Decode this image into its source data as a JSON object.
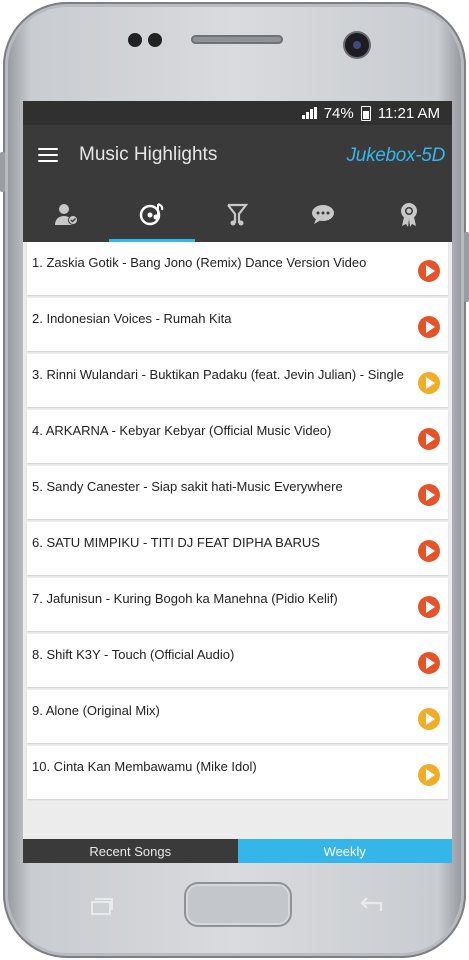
{
  "status_bar": {
    "signal": "signal-icon",
    "battery": "74%",
    "time": "11:21 AM"
  },
  "app_bar": {
    "title": "Music Highlights",
    "logo": "Jukebox-5D"
  },
  "tabs": [
    {
      "icon": "user-check-icon",
      "active": false
    },
    {
      "icon": "music-disc-icon",
      "active": true
    },
    {
      "icon": "music-chart-icon",
      "active": false
    },
    {
      "icon": "chat-icon",
      "active": false
    },
    {
      "icon": "award-icon",
      "active": false
    }
  ],
  "songs": [
    {
      "label": "1.  Zaskia Gotik - Bang Jono (Remix) Dance Version Video",
      "play_color": "red"
    },
    {
      "label": "2.  Indonesian Voices - Rumah Kita",
      "play_color": "red"
    },
    {
      "label": "3.  Rinni Wulandari - Buktikan Padaku (feat. Jevin Julian) - Single",
      "play_color": "yellow"
    },
    {
      "label": "4.  ARKARNA - Kebyar Kebyar (Official Music Video)",
      "play_color": "red"
    },
    {
      "label": "5.  Sandy Canester - Siap sakit hati-Music Everywhere",
      "play_color": "red"
    },
    {
      "label": "6.  SATU MIMPIKU - TITI DJ FEAT DIPHA BARUS",
      "play_color": "red"
    },
    {
      "label": "7.  Jafunisun - Kuring Bogoh ka Manehna (Pidio Kelif)",
      "play_color": "red"
    },
    {
      "label": "8.  Shift K3Y - Touch (Official Audio)",
      "play_color": "red"
    },
    {
      "label": "9.  Alone (Original Mix)",
      "play_color": "yellow"
    },
    {
      "label": "10.  Cinta Kan Membawamu (Mike Idol)",
      "play_color": "yellow"
    }
  ],
  "bottom_tabs": {
    "recent": "Recent Songs",
    "weekly": "Weekly"
  },
  "colors": {
    "accent": "#35b6ea",
    "play_red": "#e5532b",
    "play_yellow": "#f0ad28",
    "bar": "#3a3a3a"
  }
}
